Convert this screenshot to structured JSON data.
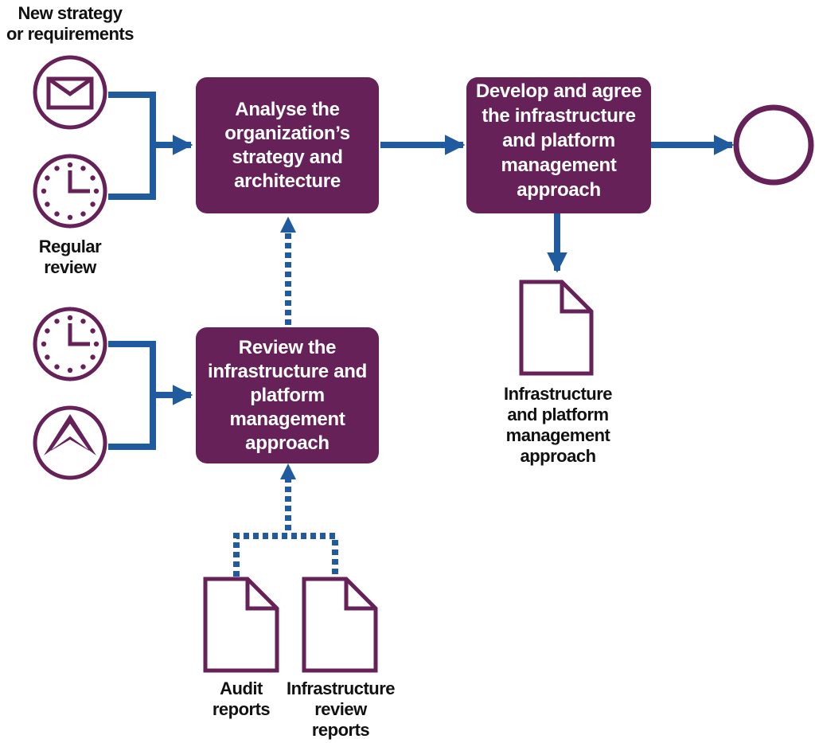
{
  "colors": {
    "activity": "#652158",
    "flow": "#1f5b9e",
    "outline": "#652158",
    "text": "#111111"
  },
  "events": {
    "new_strategy": {
      "icon": "envelope-icon",
      "label": "New strategy\nor requirements"
    },
    "regular_review": {
      "icon": "clock-icon",
      "label": "Regular\nreview"
    },
    "review_timer": {
      "icon": "clock-icon"
    },
    "review_trigger": {
      "icon": "chevron-up-icon"
    },
    "end": {
      "icon": "end-event-circle"
    }
  },
  "activities": {
    "analyse": "Analyse the\norganization’s\nstrategy and\narchitecture",
    "develop": "Develop and agree\nthe infrastructure\nand platform\nmanagement\napproach",
    "review": "Review the\ninfrastructure and\nplatform\nmanagement\napproach"
  },
  "documents": {
    "output": "Infrastructure\nand platform\nmanagement\napproach",
    "audit": "Audit\nreports",
    "infra_review": "Infrastructure\nreview\nreports"
  }
}
